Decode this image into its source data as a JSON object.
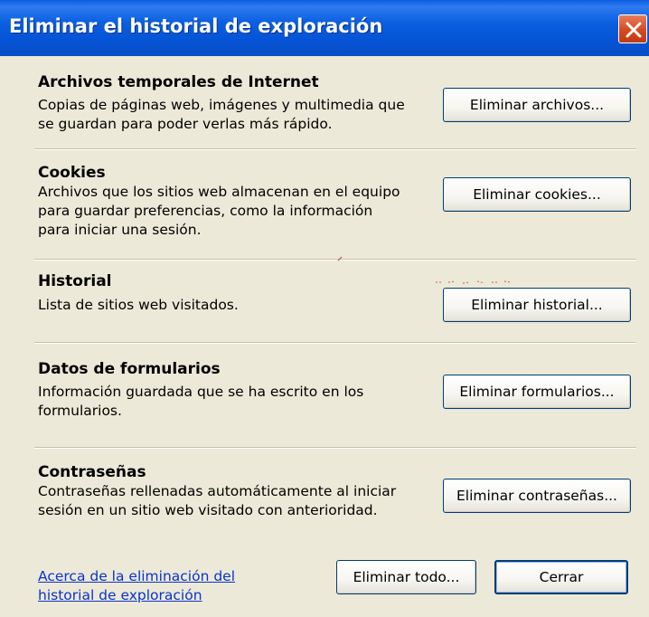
{
  "window": {
    "title": "Eliminar el historial de exploración"
  },
  "sections": [
    {
      "title": "Archivos temporales de Internet",
      "description": "Copias de páginas web, imágenes y multimedia que se guardan para poder verlas más rápido.",
      "button": "Eliminar archivos..."
    },
    {
      "title": "Cookies",
      "description": "Archivos que los sitios web almacenan en el equipo para guardar preferencias, como la información para iniciar una sesión.",
      "button": "Eliminar cookies..."
    },
    {
      "title": "Historial",
      "description": "Lista de sitios web visitados.",
      "button": "Eliminar historial..."
    },
    {
      "title": "Datos de formularios",
      "description": "Información guardada que se ha escrito en los formularios.",
      "button": "Eliminar formularios..."
    },
    {
      "title": "Contraseñas",
      "description": "Contraseñas rellenadas automáticamente al iniciar sesión en un sitio web visitado con anterioridad.",
      "button": "Eliminar contraseñas..."
    }
  ],
  "footer": {
    "link_line1": "Acerca de la eliminación del",
    "link_line2": "historial de exploración",
    "delete_all": "Eliminar todo...",
    "close": "Cerrar"
  },
  "colors": {
    "titlebar": "#0553d4",
    "close_button": "#d44a1f",
    "dialog_background": "#ece9d8",
    "link": "#0a33cc",
    "button_border": "#003c74"
  },
  "icons": [
    "close-icon"
  ]
}
